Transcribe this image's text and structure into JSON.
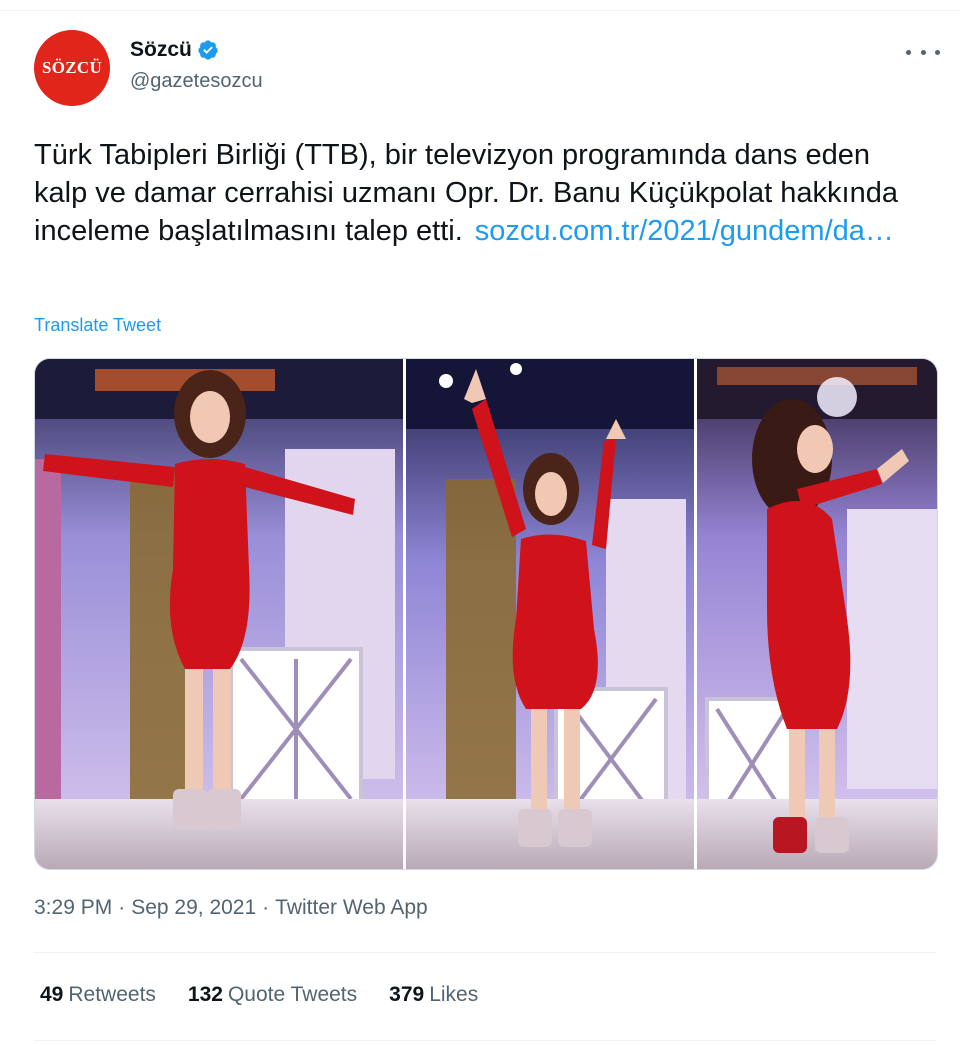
{
  "author": {
    "avatar_text": "SÖZCÜ",
    "display_name": "Sözcü",
    "handle": "@gazetesozcu",
    "verified": true
  },
  "tweet": {
    "text": "Türk Tabipleri Birliği (TTB), bir televizyon programında dans eden kalp ve damar cerrahisi uzmanı Opr. Dr. Banu Küçükpolat hakkında inceleme başlatılmasını talep etti.",
    "link": "sozcu.com.tr/2021/gundem/da…",
    "translate_label": "Translate Tweet"
  },
  "meta": {
    "time": "3:29 PM",
    "separator": "·",
    "date": "Sep 29, 2021",
    "source": "Twitter Web App"
  },
  "stats": {
    "retweets_count": "49",
    "retweets_label": "Retweets",
    "quotes_count": "132",
    "quotes_label": "Quote Tweets",
    "likes_count": "379",
    "likes_label": "Likes"
  },
  "colors": {
    "brand_red": "#e1251b",
    "link_blue": "#1d9bf0",
    "secondary_text": "#536471",
    "dress_red": "#d0121b"
  },
  "icons": {
    "verified": "verified-badge-icon",
    "more": "more-options-icon"
  }
}
